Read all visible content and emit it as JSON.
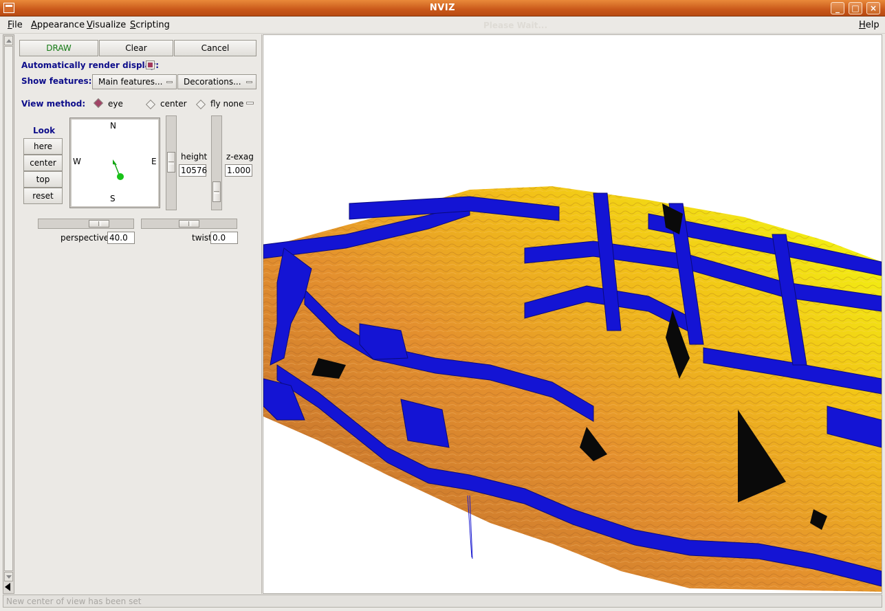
{
  "window": {
    "title": "NVIZ",
    "controls": [
      "_",
      "□",
      "×"
    ]
  },
  "menubar": {
    "items": [
      {
        "label": "File",
        "mnemonic": "F",
        "rest": "ile"
      },
      {
        "label": "Appearance",
        "mnemonic": "A",
        "rest": "ppearance"
      },
      {
        "label": "Visualize",
        "mnemonic": "V",
        "rest": "isualize"
      },
      {
        "label": "Scripting",
        "mnemonic": "S",
        "rest": "cripting"
      }
    ],
    "status": "Please Wait...",
    "help": {
      "label": "Help",
      "mnemonic": "H",
      "rest": "elp"
    }
  },
  "panel": {
    "buttons": {
      "draw": "DRAW",
      "clear": "Clear",
      "cancel": "Cancel"
    },
    "auto_render_label": "Automatically render display:",
    "auto_render_checked": true,
    "show_features_label": "Show features:",
    "main_features": "Main features...",
    "decorations": "Decorations...",
    "view_method_label": "View method:",
    "view_methods": [
      {
        "label": "eye",
        "selected": true
      },
      {
        "label": "center",
        "selected": false
      },
      {
        "label": "fly none",
        "selected": false
      }
    ],
    "look": {
      "title": "Look",
      "buttons": [
        "here",
        "center",
        "top",
        "reset"
      ]
    },
    "compass": {
      "n": "N",
      "s": "S",
      "e": "E",
      "w": "W"
    },
    "height": {
      "label": "height",
      "value": "10576"
    },
    "zexag": {
      "label": "z-exag",
      "value": "1.000"
    },
    "perspective": {
      "label": "perspective",
      "value": "40.0"
    },
    "twist": {
      "label": "twist",
      "value": "0.0"
    }
  },
  "statusbar": {
    "message": "New center of view has been set"
  },
  "colors": {
    "title_bar": "#d46a2a",
    "panel_bg": "#ebe9e5",
    "label_blue": "#0d0d8a",
    "vector_walls": "#1515d6",
    "terrain_low": "#c8702a",
    "terrain_high": "#f0ee10"
  }
}
